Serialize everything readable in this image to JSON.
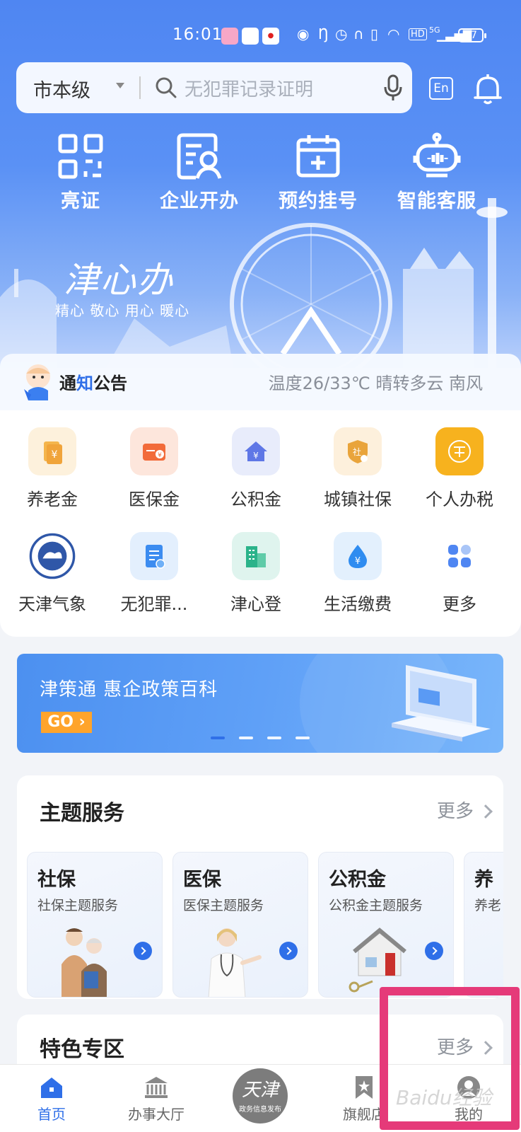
{
  "status": {
    "time": "16:01",
    "battery": "97",
    "network": "5G"
  },
  "search": {
    "region": "市本级",
    "placeholder": "无犯罪记录证明",
    "lang_button": "En"
  },
  "quick_actions": [
    {
      "label": "亮证",
      "icon": "qr-grid-icon"
    },
    {
      "label": "企业开办",
      "icon": "business-card-icon"
    },
    {
      "label": "预约挂号",
      "icon": "calendar-plus-icon"
    },
    {
      "label": "智能客服",
      "icon": "robot-icon"
    }
  ],
  "brand": {
    "logo_text": "津心办",
    "slogan": "精心 敬心 用心 暖心"
  },
  "notice": {
    "title_prefix": "通",
    "title_highlight": "知",
    "title_suffix": "公告",
    "weather": "温度26/33℃ 晴转多云 南风"
  },
  "services": [
    {
      "label": "养老金",
      "icon": "pension-icon",
      "bg": "#fdf1dc",
      "color": "#f0a43a"
    },
    {
      "label": "医保金",
      "icon": "medical-insurance-icon",
      "bg": "#fde6dc",
      "color": "#f26b3a"
    },
    {
      "label": "公积金",
      "icon": "housing-fund-icon",
      "bg": "#e8ecfb",
      "color": "#5f77e6"
    },
    {
      "label": "城镇社保",
      "icon": "social-security-icon",
      "bg": "#fdf0dc",
      "color": "#e9a43b"
    },
    {
      "label": "个人办税",
      "icon": "tax-emblem-icon",
      "bg": "#f7b21e",
      "color": "#ffffff"
    },
    {
      "label": "天津气象",
      "icon": "weather-bureau-icon",
      "bg": "#ffffff",
      "color": "#2f57a8"
    },
    {
      "label": "无犯罪...",
      "icon": "certificate-icon",
      "bg": "#e3effd",
      "color": "#3c8cf0"
    },
    {
      "label": "津心登",
      "icon": "building-icon",
      "bg": "#dff4ee",
      "color": "#2bb38a"
    },
    {
      "label": "生活缴费",
      "icon": "water-drop-icon",
      "bg": "#e3f0fd",
      "color": "#2f8cf0"
    },
    {
      "label": "更多",
      "icon": "more-grid-icon",
      "bg": "#ffffff",
      "color": "#4f86f2"
    }
  ],
  "banner": {
    "title": "津策通 惠企政策百科",
    "go": "GO"
  },
  "theme_section": {
    "title": "主题服务",
    "more": "更多",
    "items": [
      {
        "title": "社保",
        "subtitle": "社保主题服务"
      },
      {
        "title": "医保",
        "subtitle": "医保主题服务"
      },
      {
        "title": "公积金",
        "subtitle": "公积金主题服务"
      },
      {
        "title": "养",
        "subtitle": "养老"
      }
    ]
  },
  "featured_section": {
    "title": "特色专区",
    "more": "更多"
  },
  "nav": {
    "home": "首页",
    "hall": "办事大厅",
    "center_big": "天津",
    "center_small": "政务信息发布",
    "flagship": "旗舰店",
    "mine": "我的"
  },
  "watermark": "Baidu经验"
}
